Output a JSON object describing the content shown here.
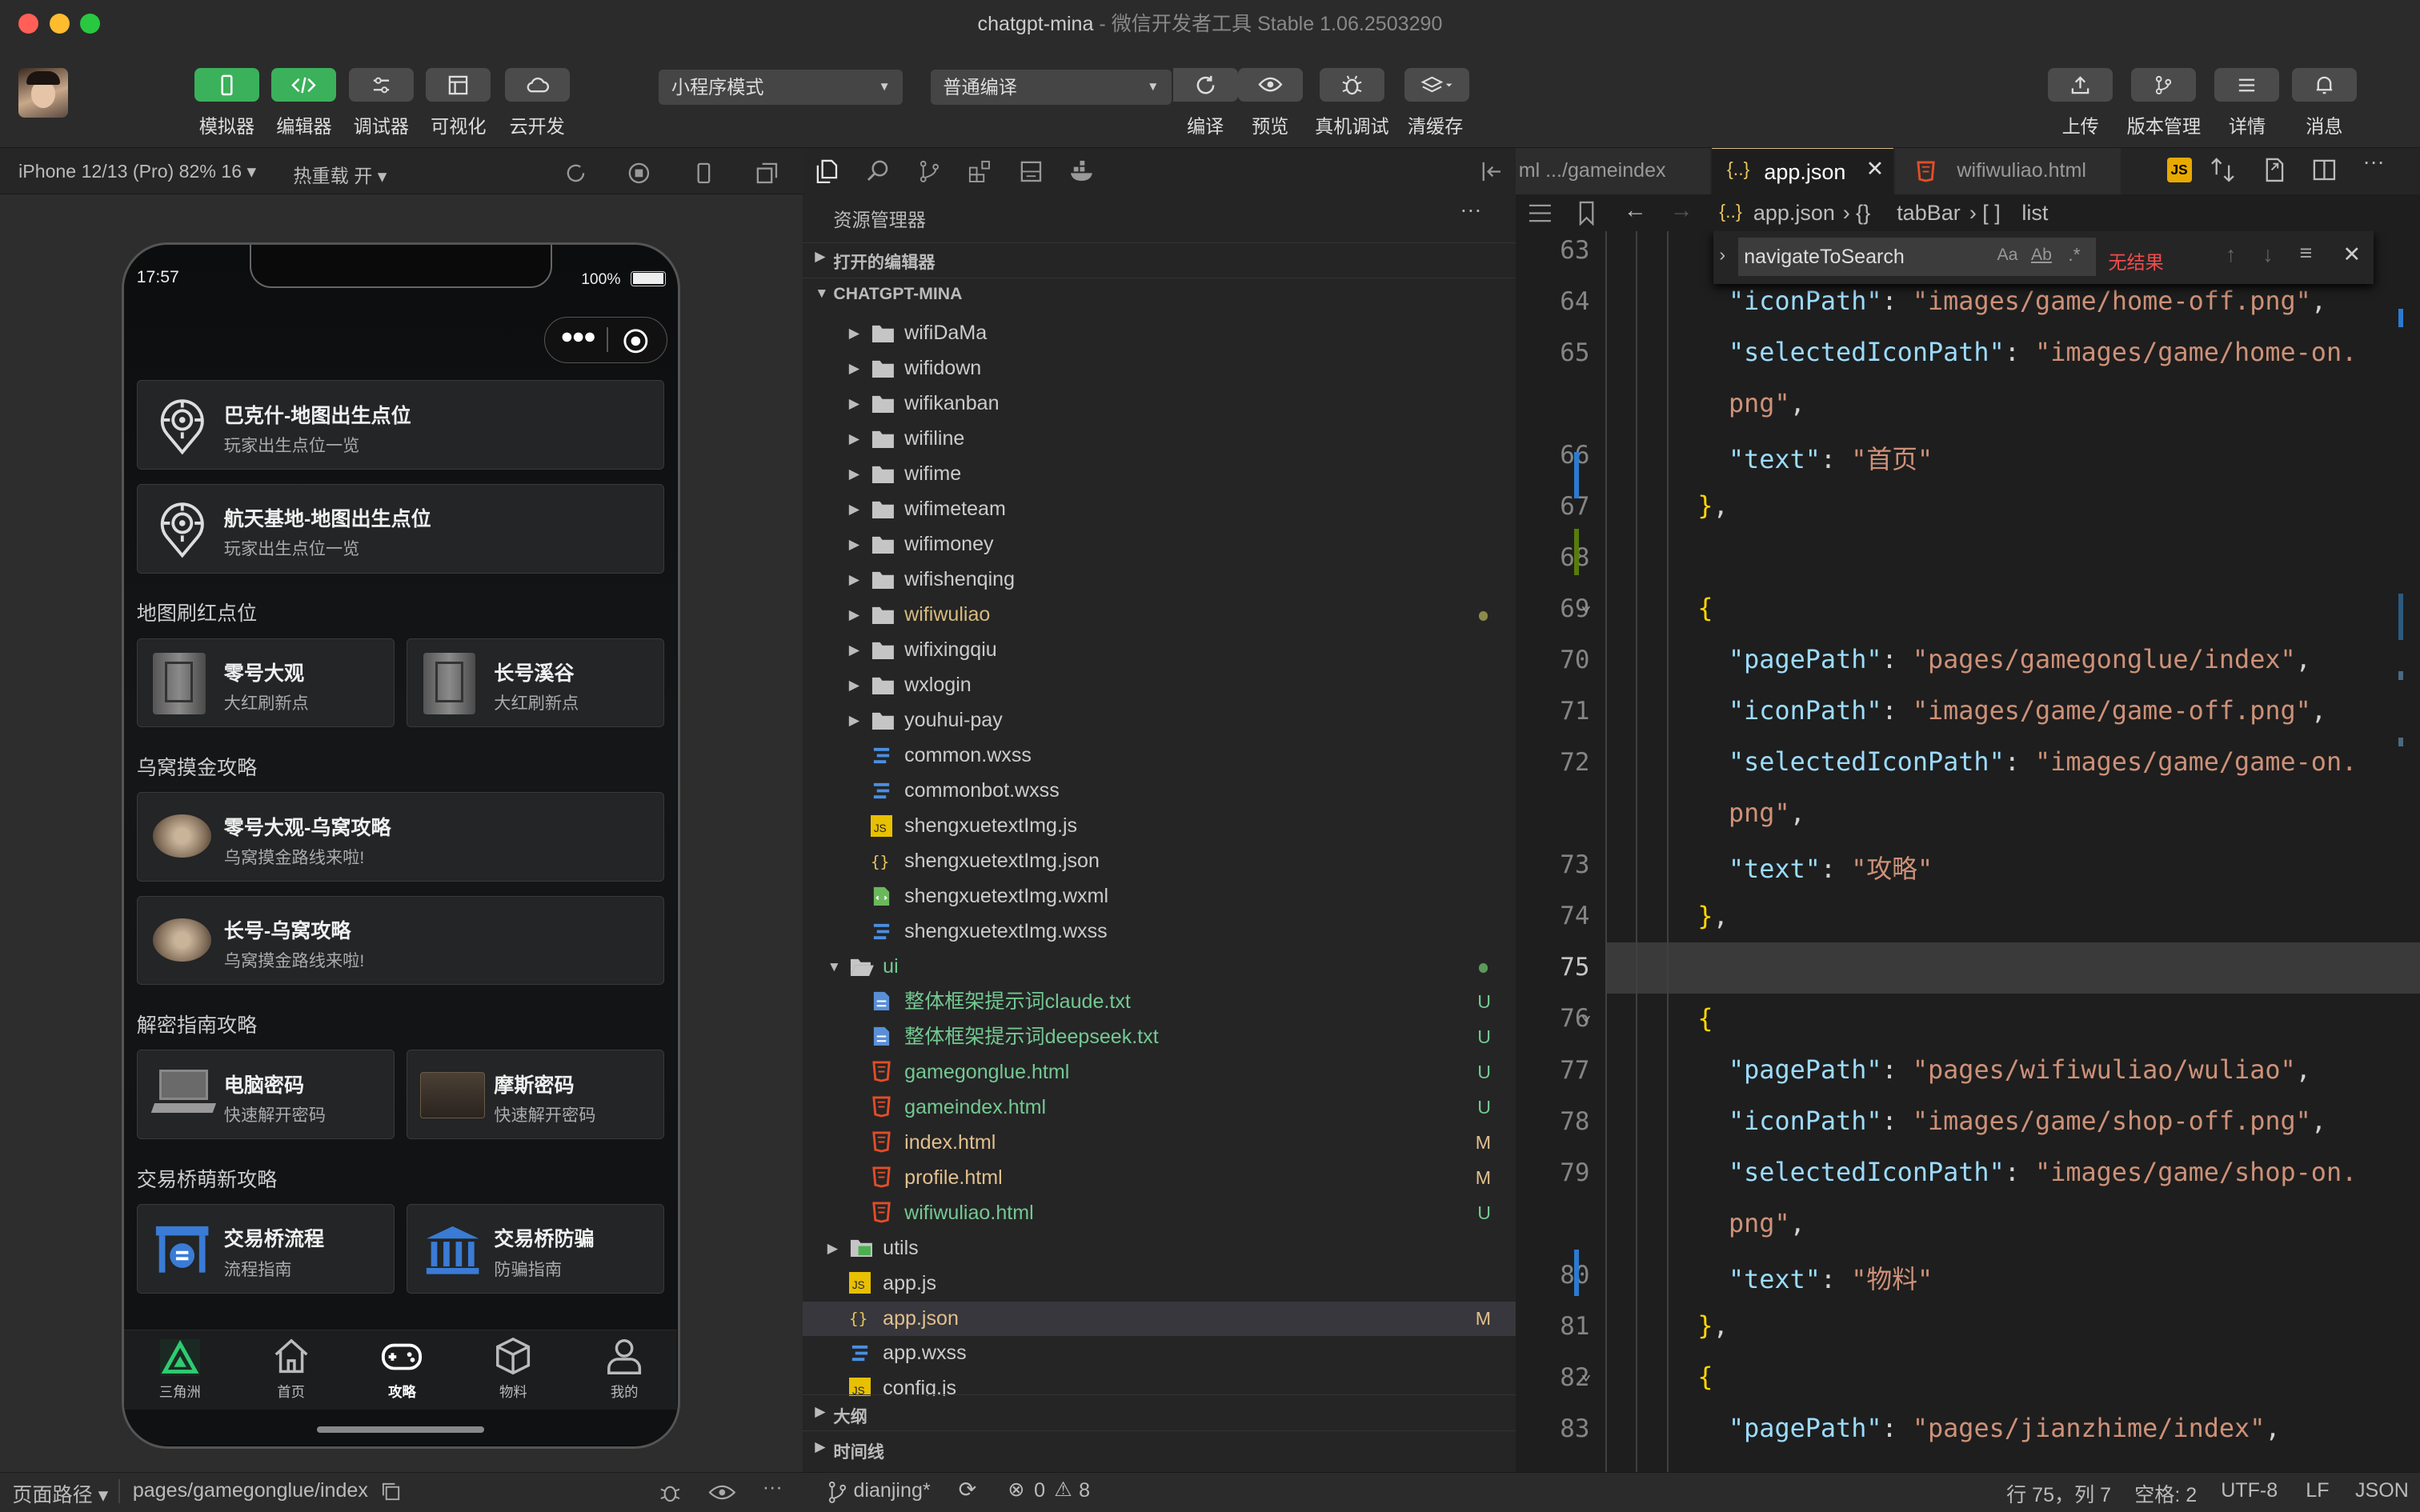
{
  "window": {
    "title": "chatgpt-mina",
    "subtitle": " - 微信开发者工具 Stable 1.06.2503290"
  },
  "toolbar": {
    "left_buttons": [
      {
        "label": "模拟器",
        "icon": "phone-icon"
      },
      {
        "label": "编辑器",
        "icon": "code-icon"
      },
      {
        "label": "调试器",
        "icon": "debug-icon"
      },
      {
        "label": "可视化",
        "icon": "layout-icon"
      },
      {
        "label": "云开发",
        "icon": "cloud-icon"
      }
    ],
    "mode_select": "小程序模式",
    "compile_select": "普通编译",
    "mid_buttons": [
      {
        "label": "编译",
        "icon": "refresh-icon"
      },
      {
        "label": "预览",
        "icon": "eye-icon"
      },
      {
        "label": "真机调试",
        "icon": "bug-icon"
      },
      {
        "label": "清缓存",
        "icon": "layers-icon"
      }
    ],
    "right_buttons": [
      {
        "label": "上传",
        "icon": "upload-icon"
      },
      {
        "label": "版本管理",
        "icon": "branch-icon"
      },
      {
        "label": "详情",
        "icon": "menu-icon"
      },
      {
        "label": "消息",
        "icon": "bell-icon"
      }
    ]
  },
  "simulator": {
    "device": "iPhone 12/13 (Pro) 82% 16 ▾",
    "hot_reload": "热重载 开 ▾",
    "phone": {
      "time": "17:57",
      "battery": "100%",
      "cards_top": [
        {
          "title": "巴克什-地图出生点位",
          "sub": "玩家出生点位一览"
        },
        {
          "title": "航天基地-地图出生点位",
          "sub": "玩家出生点位一览"
        }
      ],
      "sections": [
        {
          "title": "地图刷红点位",
          "items": [
            {
              "title": "零号大观",
              "sub": "大红刷新点"
            },
            {
              "title": "长号溪谷",
              "sub": "大红刷新点"
            }
          ]
        },
        {
          "title": "乌窝摸金攻略",
          "items": [
            {
              "title": "零号大观-乌窝攻略",
              "sub": "乌窝摸金路线来啦!"
            },
            {
              "title": "长号-乌窝攻略",
              "sub": "乌窝摸金路线来啦!"
            }
          ]
        },
        {
          "title": "解密指南攻略",
          "items": [
            {
              "title": "电脑密码",
              "sub": "快速解开密码"
            },
            {
              "title": "摩斯密码",
              "sub": "快速解开密码"
            }
          ]
        },
        {
          "title": "交易桥萌新攻略",
          "items": [
            {
              "title": "交易桥流程",
              "sub": "流程指南"
            },
            {
              "title": "交易桥防骗",
              "sub": "防骗指南"
            }
          ]
        }
      ],
      "tabbar": [
        "三角洲",
        "首页",
        "攻略",
        "物料",
        "我的"
      ],
      "active_tab": "攻略"
    }
  },
  "explorer": {
    "title": "资源管理器",
    "open_editors": "打开的编辑器",
    "project": "CHATGPT-MINA",
    "rows": [
      {
        "name": "wifiDaMa",
        "type": "folder",
        "depth": 1
      },
      {
        "name": "wifidown",
        "type": "folder",
        "depth": 1
      },
      {
        "name": "wifikanban",
        "type": "folder",
        "depth": 1
      },
      {
        "name": "wifiline",
        "type": "folder",
        "depth": 1
      },
      {
        "name": "wifime",
        "type": "folder",
        "depth": 1
      },
      {
        "name": "wifimeteam",
        "type": "folder",
        "depth": 1
      },
      {
        "name": "wifimoney",
        "type": "folder",
        "depth": 1
      },
      {
        "name": "wifishenqing",
        "type": "folder",
        "depth": 1
      },
      {
        "name": "wifiwuliao",
        "type": "folder",
        "depth": 1,
        "color": "#d7ba7d",
        "dot": "#8a8a4a"
      },
      {
        "name": "wifixingqiu",
        "type": "folder",
        "depth": 1
      },
      {
        "name": "wxlogin",
        "type": "folder",
        "depth": 1
      },
      {
        "name": "youhui-pay",
        "type": "folder",
        "depth": 1
      },
      {
        "name": "common.wxss",
        "type": "wxss",
        "depth": 1
      },
      {
        "name": "commonbot.wxss",
        "type": "wxss",
        "depth": 1
      },
      {
        "name": "shengxuetextImg.js",
        "type": "js",
        "depth": 1
      },
      {
        "name": "shengxuetextImg.json",
        "type": "json",
        "depth": 1
      },
      {
        "name": "shengxuetextImg.wxml",
        "type": "wxml",
        "depth": 1
      },
      {
        "name": "shengxuetextImg.wxss",
        "type": "wxss",
        "depth": 1
      },
      {
        "name": "ui",
        "type": "folder-open",
        "depth": 0,
        "color": "#73c991",
        "dot": "#5a9a5a"
      },
      {
        "name": "整体框架提示词claude.txt",
        "type": "txt",
        "depth": 1,
        "color": "#73c991",
        "status": "U"
      },
      {
        "name": "整体框架提示词deepseek.txt",
        "type": "txt",
        "depth": 1,
        "color": "#73c991",
        "status": "U"
      },
      {
        "name": "gamegonglue.html",
        "type": "html",
        "depth": 1,
        "color": "#73c991",
        "status": "U"
      },
      {
        "name": "gameindex.html",
        "type": "html",
        "depth": 1,
        "color": "#73c991",
        "status": "U"
      },
      {
        "name": "index.html",
        "type": "html",
        "depth": 1,
        "color": "#e2c08d",
        "status": "M"
      },
      {
        "name": "profile.html",
        "type": "html",
        "depth": 1,
        "color": "#e2c08d",
        "status": "M"
      },
      {
        "name": "wifiwuliao.html",
        "type": "html",
        "depth": 1,
        "color": "#73c991",
        "status": "U"
      },
      {
        "name": "utils",
        "type": "folder-green",
        "depth": 0
      },
      {
        "name": "app.js",
        "type": "js",
        "depth": 0
      },
      {
        "name": "app.json",
        "type": "json",
        "depth": 0,
        "color": "#e2c08d",
        "status": "M",
        "selected": true
      },
      {
        "name": "app.wxss",
        "type": "wxss",
        "depth": 0
      },
      {
        "name": "config.js",
        "type": "js",
        "depth": 0
      }
    ],
    "outline": "大纲",
    "timeline": "时间线"
  },
  "editor": {
    "tabs": [
      {
        "label": "ml .../gameindex",
        "active": false
      },
      {
        "label": "app.json",
        "active": true
      },
      {
        "label": "wifiwuliao.html",
        "active": false
      }
    ],
    "breadcrumb": [
      "app.json",
      "tabBar",
      "list"
    ],
    "find": {
      "query": "navigateToSearch",
      "result": "无结果"
    },
    "lines": [
      {
        "n": "63",
        "parts": []
      },
      {
        "n": "64",
        "parts": [
          [
            "k",
            "\"iconPath\""
          ],
          [
            "p",
            ": "
          ],
          [
            "v",
            "\"images/game/home-off.png\""
          ],
          [
            "p",
            ","
          ]
        ]
      },
      {
        "n": "65",
        "parts": [
          [
            "k",
            "\"selectedIconPath\""
          ],
          [
            "p",
            ": "
          ],
          [
            "v",
            "\"images/game/home-on."
          ]
        ]
      },
      {
        "n": "",
        "parts": [
          [
            "v",
            "png\""
          ],
          [
            "p",
            ","
          ]
        ]
      },
      {
        "n": "66",
        "parts": [
          [
            "k",
            "\"text\""
          ],
          [
            "p",
            ": "
          ],
          [
            "v",
            "\"首页\""
          ]
        ]
      },
      {
        "n": "67",
        "parts": [
          [
            "b",
            "}"
          ],
          [
            "p",
            ","
          ]
        ],
        "indent": 1
      },
      {
        "n": "68",
        "parts": []
      },
      {
        "n": "69",
        "parts": [
          [
            "b",
            "{"
          ]
        ],
        "indent": 1
      },
      {
        "n": "70",
        "parts": [
          [
            "k",
            "\"pagePath\""
          ],
          [
            "p",
            ": "
          ],
          [
            "v",
            "\"pages/gamegonglue/index\""
          ],
          [
            "p",
            ","
          ]
        ]
      },
      {
        "n": "71",
        "parts": [
          [
            "k",
            "\"iconPath\""
          ],
          [
            "p",
            ": "
          ],
          [
            "v",
            "\"images/game/game-off.png\""
          ],
          [
            "p",
            ","
          ]
        ]
      },
      {
        "n": "72",
        "parts": [
          [
            "k",
            "\"selectedIconPath\""
          ],
          [
            "p",
            ": "
          ],
          [
            "v",
            "\"images/game/game-on."
          ]
        ]
      },
      {
        "n": "",
        "parts": [
          [
            "v",
            "png\""
          ],
          [
            "p",
            ","
          ]
        ]
      },
      {
        "n": "73",
        "parts": [
          [
            "k",
            "\"text\""
          ],
          [
            "p",
            ": "
          ],
          [
            "v",
            "\"攻略\""
          ]
        ]
      },
      {
        "n": "74",
        "parts": [
          [
            "b",
            "}"
          ],
          [
            "p",
            ","
          ]
        ],
        "indent": 1
      },
      {
        "n": "75",
        "parts": [],
        "current": true
      },
      {
        "n": "76",
        "parts": [
          [
            "b",
            "{"
          ]
        ],
        "indent": 1
      },
      {
        "n": "77",
        "parts": [
          [
            "k",
            "\"pagePath\""
          ],
          [
            "p",
            ": "
          ],
          [
            "v",
            "\"pages/wifiwuliao/wuliao\""
          ],
          [
            "p",
            ","
          ]
        ]
      },
      {
        "n": "78",
        "parts": [
          [
            "k",
            "\"iconPath\""
          ],
          [
            "p",
            ": "
          ],
          [
            "v",
            "\"images/game/shop-off.png\""
          ],
          [
            "p",
            ","
          ]
        ]
      },
      {
        "n": "79",
        "parts": [
          [
            "k",
            "\"selectedIconPath\""
          ],
          [
            "p",
            ": "
          ],
          [
            "v",
            "\"images/game/shop-on."
          ]
        ]
      },
      {
        "n": "",
        "parts": [
          [
            "v",
            "png\""
          ],
          [
            "p",
            ","
          ]
        ]
      },
      {
        "n": "80",
        "parts": [
          [
            "k",
            "\"text\""
          ],
          [
            "p",
            ": "
          ],
          [
            "v",
            "\"物料\""
          ]
        ]
      },
      {
        "n": "81",
        "parts": [
          [
            "b",
            "}"
          ],
          [
            "p",
            ","
          ]
        ],
        "indent": 1
      },
      {
        "n": "82",
        "parts": [
          [
            "b",
            "{"
          ]
        ],
        "indent": 1
      },
      {
        "n": "83",
        "parts": [
          [
            "k",
            "\"pagePath\""
          ],
          [
            "p",
            ": "
          ],
          [
            "v",
            "\"pages/jianzhime/index\""
          ],
          [
            "p",
            ","
          ]
        ]
      }
    ]
  },
  "statusbar": {
    "path_label": "页面路径 ▾",
    "path": "pages/gamegonglue/index",
    "branch": "dianjing*",
    "errors": "0",
    "warnings": "8",
    "cursor": "行 75，列 7",
    "indent": "空格: 2",
    "encoding": "UTF-8",
    "eol": "LF",
    "lang": "JSON"
  },
  "colors": {
    "green": "#3bb15b",
    "modified": "#e2c08d",
    "untracked": "#73c991",
    "error": "#f14c4c"
  }
}
